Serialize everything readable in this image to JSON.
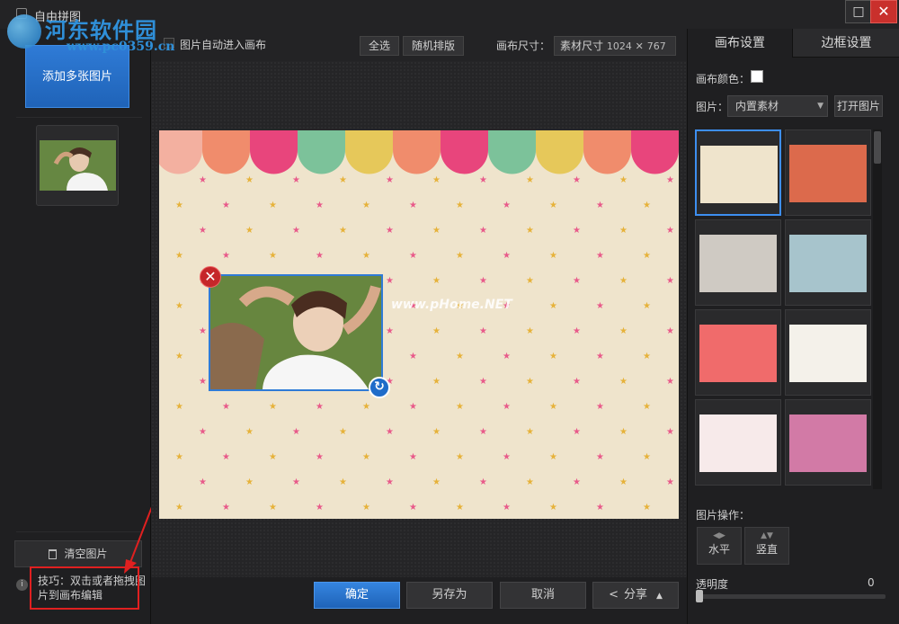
{
  "window": {
    "title": "自由拼图",
    "maximize_glyph": "□",
    "close_glyph": "✕"
  },
  "watermark": {
    "logo_text": "河东软件园",
    "logo_url": "www.pc0359.cn",
    "canvas_text": "www.pHome.NET"
  },
  "left": {
    "add_button": "添加多张图片",
    "clear_button": "清空图片",
    "tip_text": "技巧：双击或者拖拽图片到画布编辑",
    "tip_icon_glyph": "i"
  },
  "toolbar": {
    "auto_enter_label": "图片自动进入画布",
    "select_all": "全选",
    "random_layout": "随机排版",
    "canvas_size_label": "画布尺寸：",
    "size_mode": "素材尺寸",
    "width": "1024",
    "times": "✕",
    "height": "767"
  },
  "canvas": {
    "delete_glyph": "✕",
    "rotate_glyph": "↻",
    "background_color": "#efe4cc",
    "scallop_colors": [
      "#f3b0a0",
      "#f08c6c",
      "#e8457c",
      "#7cc29a",
      "#e6c85a",
      "#f08c6c",
      "#e8457c",
      "#7cc29a",
      "#e6c85a",
      "#f08c6c",
      "#e8457c"
    ],
    "star_colors": [
      "#e85a8a",
      "#e6b23a"
    ]
  },
  "bottom": {
    "ok": "确定",
    "save_as": "另存为",
    "cancel": "取消",
    "share": "分享",
    "share_glyph": "<",
    "caret_glyph": "▲"
  },
  "right": {
    "tabs": [
      "画布设置",
      "边框设置"
    ],
    "canvas_color_label": "画布颜色：",
    "image_label": "图片：",
    "image_source": "内置素材",
    "select_arrow": "▼",
    "open_image": "打开图片",
    "image_ops_label": "图片操作：",
    "flip_h": "水平",
    "flip_h_glyph": "◀▶",
    "flip_v": "竖直",
    "flip_v_glyph": "▲▼",
    "opacity_label": "透明度",
    "opacity_value": "0",
    "tiles": [
      {
        "name": "scallop-stars",
        "bg": "#efe4cc"
      },
      {
        "name": "orange-minimal",
        "bg": "#dc6a4c"
      },
      {
        "name": "grey-sketch",
        "bg": "#cfcac3"
      },
      {
        "name": "blue-daisies",
        "bg": "#a7c4cc"
      },
      {
        "name": "red-bunny",
        "bg": "#f06b6b"
      },
      {
        "name": "white-town",
        "bg": "#f4f1ea"
      },
      {
        "name": "pink-tree",
        "bg": "#f7eaea"
      },
      {
        "name": "magenta-gift",
        "bg": "#d27aa6"
      }
    ]
  }
}
